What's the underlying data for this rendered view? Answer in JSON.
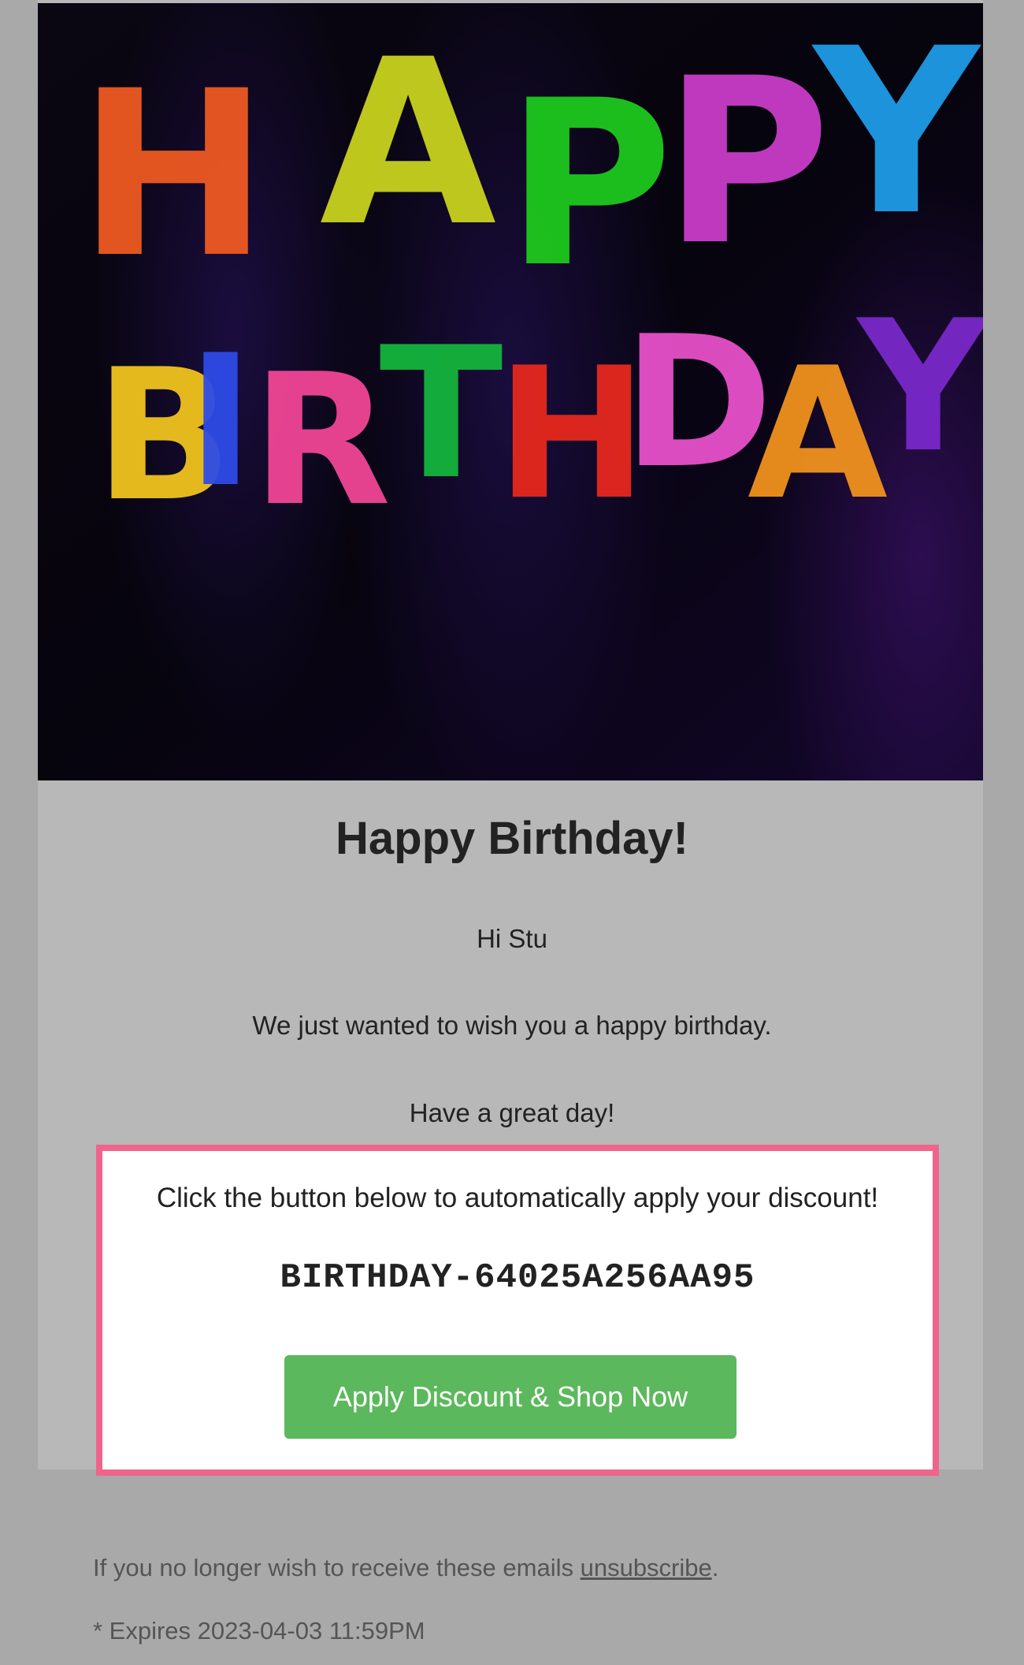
{
  "banner": {
    "row1": [
      "H",
      "A",
      "P",
      "P",
      "Y"
    ],
    "row2": [
      "B",
      "I",
      "R",
      "T",
      "H",
      "D",
      "A",
      "Y"
    ],
    "colors": {
      "background": "#05030a",
      "glow": "#2a1466",
      "letter_colors_row1": [
        "#ee5a22",
        "#c8d21e",
        "#1ec81e",
        "#c83cc8",
        "#1e9be6"
      ],
      "letter_colors_row2": [
        "#f0c31e",
        "#2d4be6",
        "#f04696",
        "#14b43c",
        "#e6281e",
        "#e650c8",
        "#f0911e",
        "#7828c8"
      ]
    }
  },
  "content": {
    "headline": "Happy Birthday!",
    "greeting": "Hi Stu",
    "message": "We just wanted to wish you a happy birthday.",
    "closing": "Have a great day!"
  },
  "discount": {
    "intro": "Click the button below to automatically apply your discount!",
    "code": "BIRTHDAY-64025A256AA95",
    "button_label": "Apply Discount & Shop Now",
    "border_color": "#f0648c",
    "button_color": "#5cb85c"
  },
  "footer": {
    "unsubscribe_prefix": "If you no longer wish to receive these emails ",
    "unsubscribe_link": "unsubscribe",
    "unsubscribe_suffix": ".",
    "expiry": "* Expires 2023-04-03 11:59PM"
  }
}
